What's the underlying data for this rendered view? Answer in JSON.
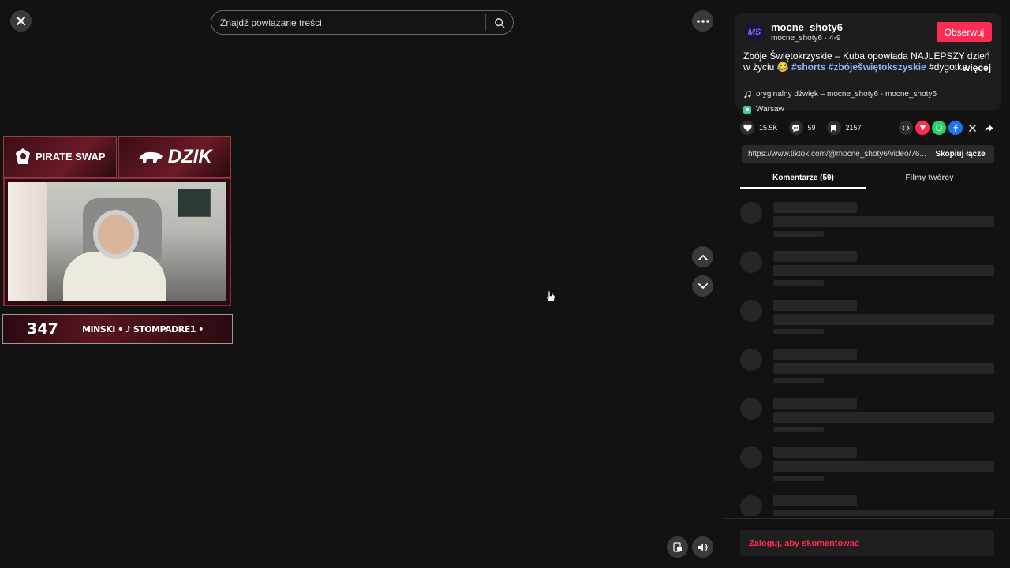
{
  "search": {
    "placeholder": "Znajdź powiązane treści"
  },
  "overlay": {
    "sponsor_a": "PIRATE SWAP",
    "sponsor_b": "DZIK",
    "count": "347",
    "ticker": "MINSKI • ♪ STOMPADRE1 •"
  },
  "author": {
    "avatar_text": "MS",
    "name": "mocne_shoty6",
    "sub": "mocne_shoty6 · 4-9",
    "follow_label": "Obserwuj"
  },
  "description": {
    "text": "Zbóje Świętokrzyskie – Kuba opowiada NAJLEPSZY dzień w życiu 😂",
    "tag1": "#shorts",
    "tag2": "#zbóješwiętokszyskie",
    "tag3": "#dygotka...",
    "more": "więcej"
  },
  "music": {
    "text": "oryginalny dźwięk – mocne_shoty6 - mocne_shoty6"
  },
  "location": {
    "text": "Warsaw"
  },
  "stats": {
    "likes": "15.5K",
    "comments": "59",
    "saves": "2157"
  },
  "link": {
    "url": "https://www.tiktok.com/@mocne_shoty6/video/76...",
    "copy_label": "Skopiuj łącze"
  },
  "tabs": {
    "comments": "Komentarze (59)",
    "creator_videos": "Filmy twórcy"
  },
  "comment_prompt": "Zaloguj, aby skomentować",
  "colors": {
    "accent": "#fe2c55",
    "hashtag": "#8ab4f8",
    "background": "#121212"
  }
}
